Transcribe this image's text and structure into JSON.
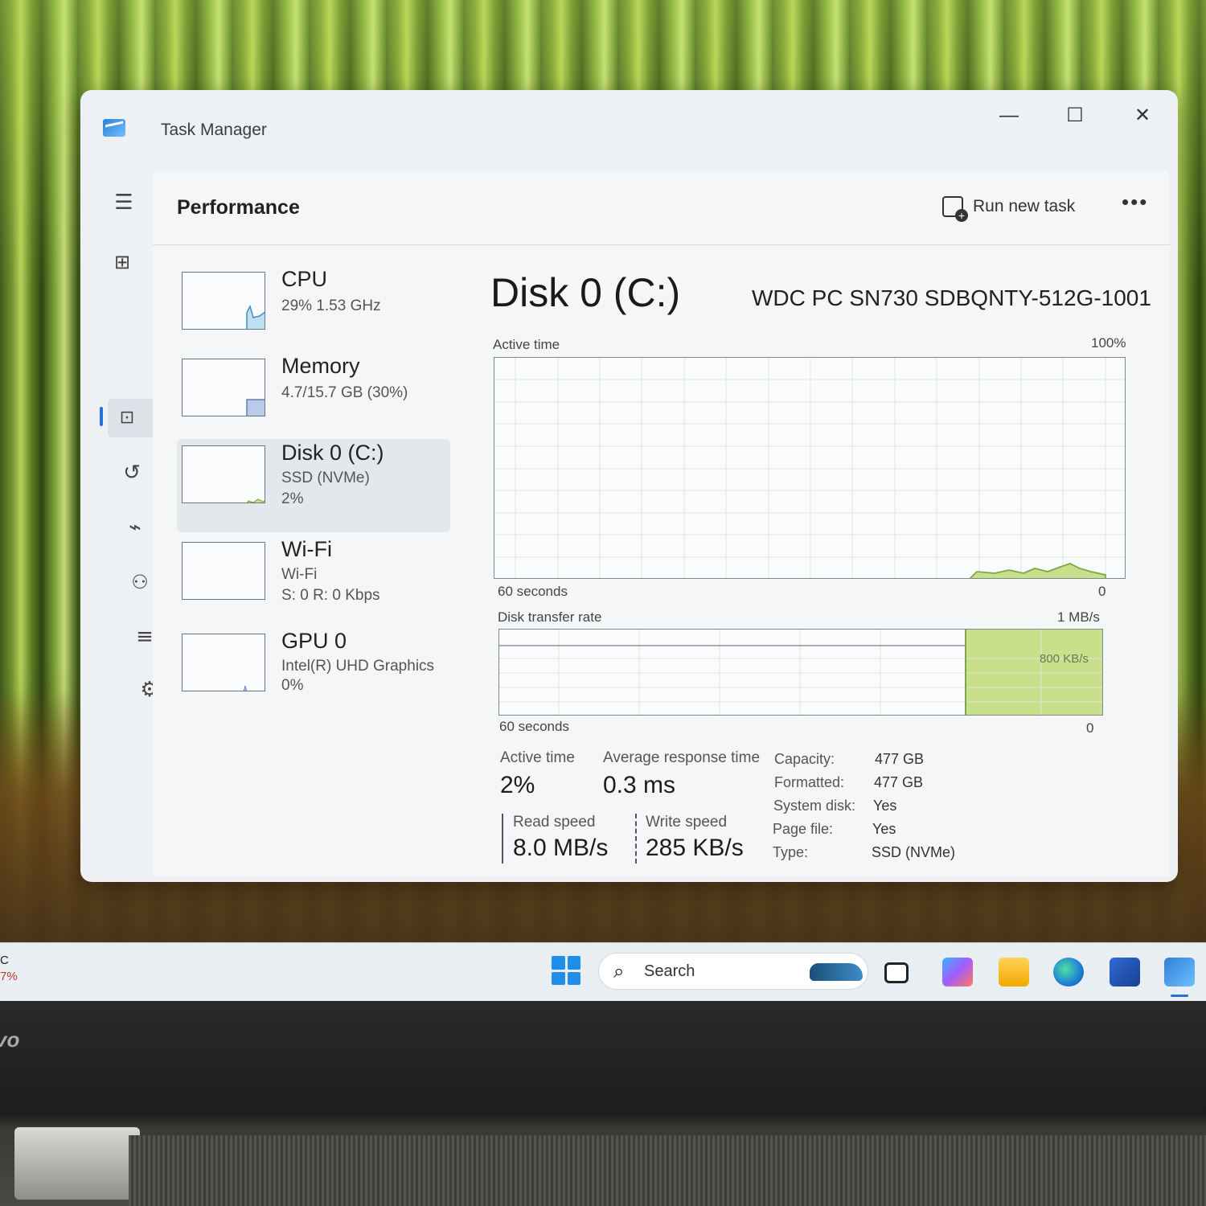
{
  "window": {
    "title": "Task Manager"
  },
  "header": {
    "page_title": "Performance",
    "run_new_task": "Run new task",
    "more": "•••"
  },
  "devices": [
    {
      "name": "CPU",
      "sub1": "29%  1.53 GHz",
      "sub2": ""
    },
    {
      "name": "Memory",
      "sub1": "4.7/15.7 GB (30%)",
      "sub2": ""
    },
    {
      "name": "Disk 0 (C:)",
      "sub1": "SSD (NVMe)",
      "sub2": "2%"
    },
    {
      "name": "Wi-Fi",
      "sub1": "Wi-Fi",
      "sub2": "S: 0 R: 0 Kbps"
    },
    {
      "name": "GPU 0",
      "sub1": "Intel(R) UHD Graphics",
      "sub2": "0%"
    }
  ],
  "detail": {
    "title": "Disk 0 (C:)",
    "model": "WDC PC SN730 SDBQNTY-512G-1001",
    "active_chart": {
      "label": "Active time",
      "max_label": "100%",
      "time_label": "60 seconds",
      "min_label": "0"
    },
    "transfer_chart": {
      "label": "Disk transfer rate",
      "max_label": "1 MB/s",
      "mid_label": "800 KB/s",
      "time_label": "60 seconds",
      "min_label": "0"
    },
    "stats": {
      "active_time_label": "Active time",
      "active_time_value": "2%",
      "avg_response_label": "Average response time",
      "avg_response_value": "0.3 ms",
      "read_speed_label": "Read speed",
      "read_speed_value": "8.0 MB/s",
      "write_speed_label": "Write speed",
      "write_speed_value": "285 KB/s"
    },
    "properties": [
      {
        "key": "Capacity:",
        "value": "477 GB"
      },
      {
        "key": "Formatted:",
        "value": "477 GB"
      },
      {
        "key": "System disk:",
        "value": "Yes"
      },
      {
        "key": "Page file:",
        "value": "Yes"
      },
      {
        "key": "Type:",
        "value": "SSD (NVMe)"
      }
    ]
  },
  "sidebar": {
    "icons": [
      "hamburger-icon",
      "processes-icon",
      "performance-icon",
      "app-history-icon",
      "startup-apps-icon",
      "users-icon",
      "details-icon",
      "services-icon",
      "settings-icon"
    ]
  },
  "taskbar": {
    "left_text_1": "C",
    "left_text_2": "7%",
    "search_placeholder": "Search"
  },
  "bezel": {
    "brand": "vo"
  },
  "colors": {
    "accent": "#2a6fd6",
    "disk_fill": "#c9e08a",
    "disk_line": "#7da84a",
    "cpu_fill": "#bfe0f2",
    "memory_fill": "#b9cbe6"
  }
}
